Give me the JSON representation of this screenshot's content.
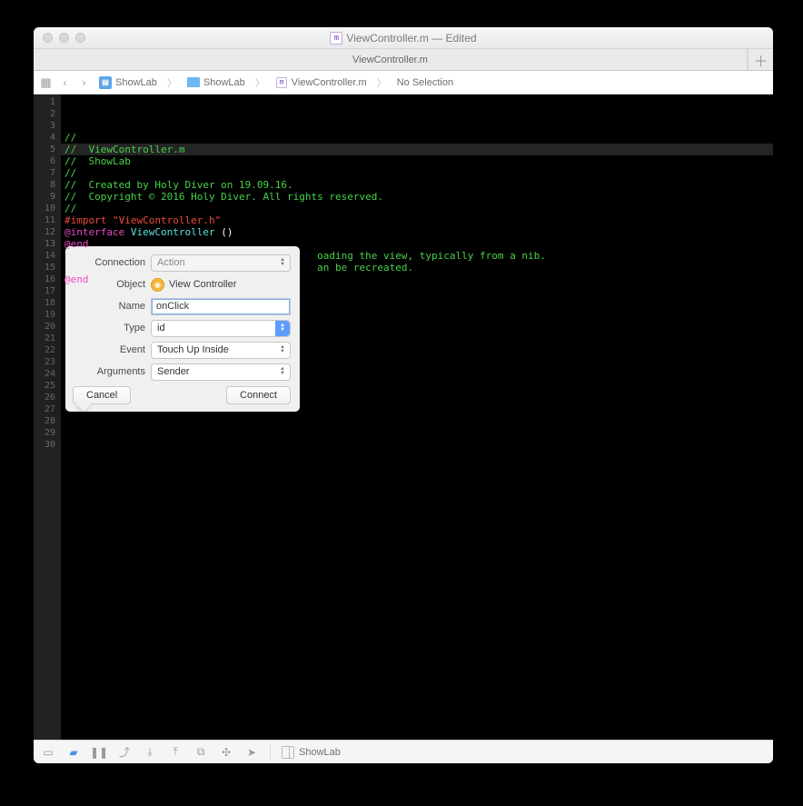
{
  "window": {
    "title_prefix_icon": "m",
    "title": "ViewController.m — Edited"
  },
  "tabs": [
    {
      "label": "ViewController.m"
    }
  ],
  "tab_plus_glyph": "＋",
  "breadcrumb": {
    "related_tooltip": "Related Items",
    "back_glyph": "‹",
    "fwd_glyph": "›",
    "items": [
      {
        "icon": "proj",
        "label": "ShowLab"
      },
      {
        "icon": "folder",
        "label": "ShowLab"
      },
      {
        "icon": "m",
        "label": "ViewController.m"
      },
      {
        "icon": "",
        "label": "No Selection"
      }
    ]
  },
  "editor": {
    "highlighted_line_index": 4,
    "total_line_numbers": 30,
    "lines": [
      {
        "t": "//",
        "cls": "c-green"
      },
      {
        "t": "//  ViewController.m",
        "cls": "c-green"
      },
      {
        "t": "//  ShowLab",
        "cls": "c-green"
      },
      {
        "t": "//",
        "cls": "c-green"
      },
      {
        "t": "//  Created by Holy Diver on 19.09.16.",
        "cls": "c-green"
      },
      {
        "t": "//  Copyright © 2016 Holy Diver. All rights reserved.",
        "cls": "c-green"
      },
      {
        "t": "//",
        "cls": "c-green"
      },
      {
        "t": "",
        "cls": ""
      },
      {
        "segments": [
          {
            "t": "#import ",
            "cls": "c-red"
          },
          {
            "t": "\"ViewController.h\"",
            "cls": "c-red"
          }
        ]
      },
      {
        "t": "",
        "cls": ""
      },
      {
        "segments": [
          {
            "t": "@interface",
            "cls": "c-magenta"
          },
          {
            "t": " ",
            "cls": ""
          },
          {
            "t": "ViewController",
            "cls": "c-cyan"
          },
          {
            "t": " ()",
            "cls": ""
          }
        ]
      },
      {
        "t": "",
        "cls": ""
      },
      {
        "t": "@end",
        "cls": "c-magenta"
      },
      {
        "t": "",
        "cls": ""
      },
      {
        "t": "",
        "cls": ""
      },
      {
        "t": "",
        "cls": ""
      },
      {
        "t": "",
        "cls": ""
      },
      {
        "t": "",
        "cls": ""
      },
      {
        "segments": [
          {
            "t": "                                          ",
            "cls": ""
          },
          {
            "t": "oading the view, typically from a nib.",
            "cls": "c-green"
          }
        ]
      },
      {
        "t": "",
        "cls": ""
      },
      {
        "t": "",
        "cls": ""
      },
      {
        "t": "",
        "cls": ""
      },
      {
        "t": "",
        "cls": ""
      },
      {
        "t": "",
        "cls": ""
      },
      {
        "segments": [
          {
            "t": "                                          ",
            "cls": ""
          },
          {
            "t": "an be recreated.",
            "cls": "c-green"
          }
        ]
      },
      {
        "t": "",
        "cls": ""
      },
      {
        "t": "",
        "cls": ""
      },
      {
        "t": "",
        "cls": ""
      },
      {
        "t": "@end",
        "cls": "c-magenta"
      },
      {
        "t": "",
        "cls": ""
      }
    ]
  },
  "popover": {
    "labels": {
      "connection": "Connection",
      "object": "Object",
      "name": "Name",
      "type": "Type",
      "event": "Event",
      "arguments": "Arguments"
    },
    "values": {
      "connection": "Action",
      "object": "View Controller",
      "name": "onClick",
      "type": "id",
      "event": "Touch Up Inside",
      "arguments": "Sender"
    },
    "buttons": {
      "cancel": "Cancel",
      "connect": "Connect"
    }
  },
  "footer": {
    "scheme_label": "ShowLab",
    "icons": [
      "panel",
      "flag",
      "pause",
      "home",
      "download",
      "upload",
      "panes",
      "branch",
      "send"
    ]
  }
}
